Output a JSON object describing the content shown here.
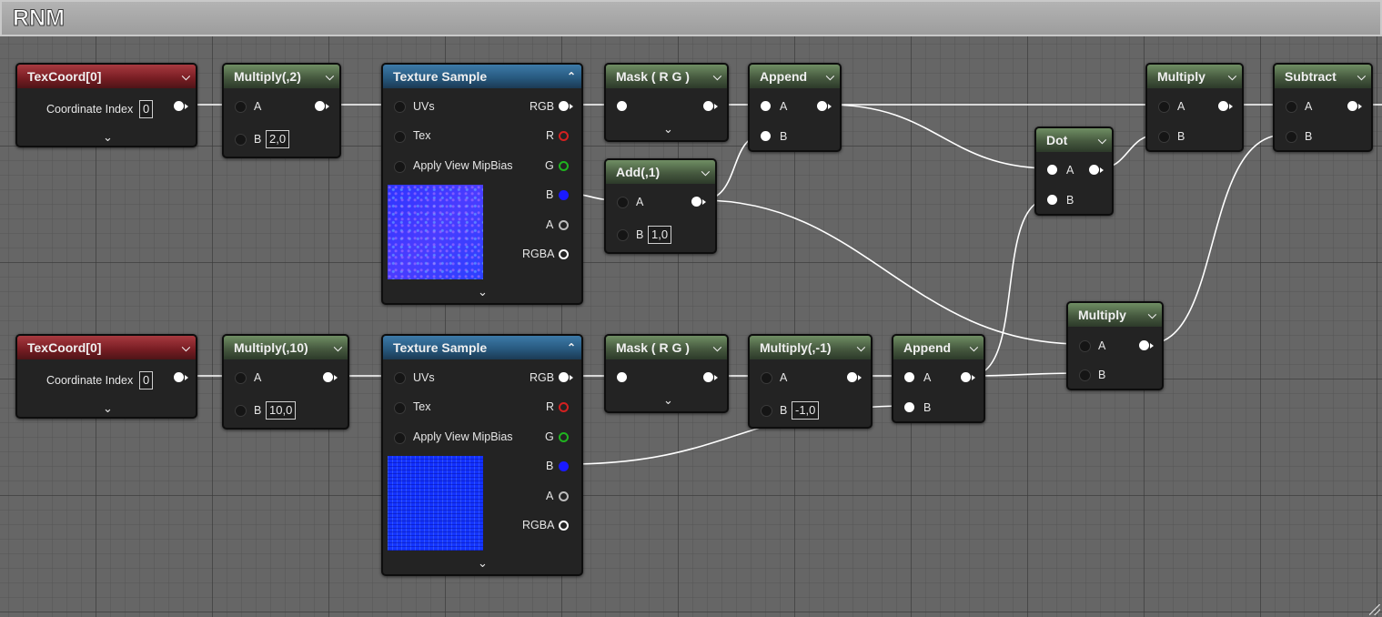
{
  "comment": {
    "title": "RNM"
  },
  "colors": {
    "wire": "#ffffff",
    "pin_r": "#d32020",
    "pin_g": "#1fb31f",
    "pin_b": "#1a1aff"
  },
  "nodes": {
    "texcoord_top": {
      "title": "TexCoord[0]",
      "coord_label": "Coordinate Index",
      "coord_value": "0"
    },
    "mul_top": {
      "title": "Multiply(,2)",
      "a": "A",
      "b": "B",
      "b_value": "2,0"
    },
    "tex_top": {
      "title": "Texture Sample",
      "uvs": "UVs",
      "tex": "Tex",
      "mip": "Apply View MipBias",
      "rgb": "RGB",
      "r": "R",
      "g": "G",
      "b": "B",
      "a": "A",
      "rgba": "RGBA"
    },
    "mask_top": {
      "title": "Mask ( R G )"
    },
    "add_top": {
      "title": "Add(,1)",
      "a": "A",
      "b": "B",
      "b_value": "1,0"
    },
    "append_top": {
      "title": "Append",
      "a": "A",
      "b": "B"
    },
    "dot": {
      "title": "Dot",
      "a": "A",
      "b": "B"
    },
    "mul_right": {
      "title": "Multiply",
      "a": "A",
      "b": "B"
    },
    "subtract": {
      "title": "Subtract",
      "a": "A",
      "b": "B"
    },
    "mul_mid": {
      "title": "Multiply",
      "a": "A",
      "b": "B"
    },
    "texcoord_bot": {
      "title": "TexCoord[0]",
      "coord_label": "Coordinate Index",
      "coord_value": "0"
    },
    "mul_bot": {
      "title": "Multiply(,10)",
      "a": "A",
      "b": "B",
      "b_value": "10,0"
    },
    "tex_bot": {
      "title": "Texture Sample",
      "uvs": "UVs",
      "tex": "Tex",
      "mip": "Apply View MipBias",
      "rgb": "RGB",
      "r": "R",
      "g": "G",
      "b": "B",
      "a": "A",
      "rgba": "RGBA"
    },
    "mask_bot": {
      "title": "Mask ( R G )"
    },
    "mul_neg": {
      "title": "Multiply(,-1)",
      "a": "A",
      "b": "B",
      "b_value": "-1,0"
    },
    "append_bot": {
      "title": "Append",
      "a": "A",
      "b": "B"
    }
  }
}
